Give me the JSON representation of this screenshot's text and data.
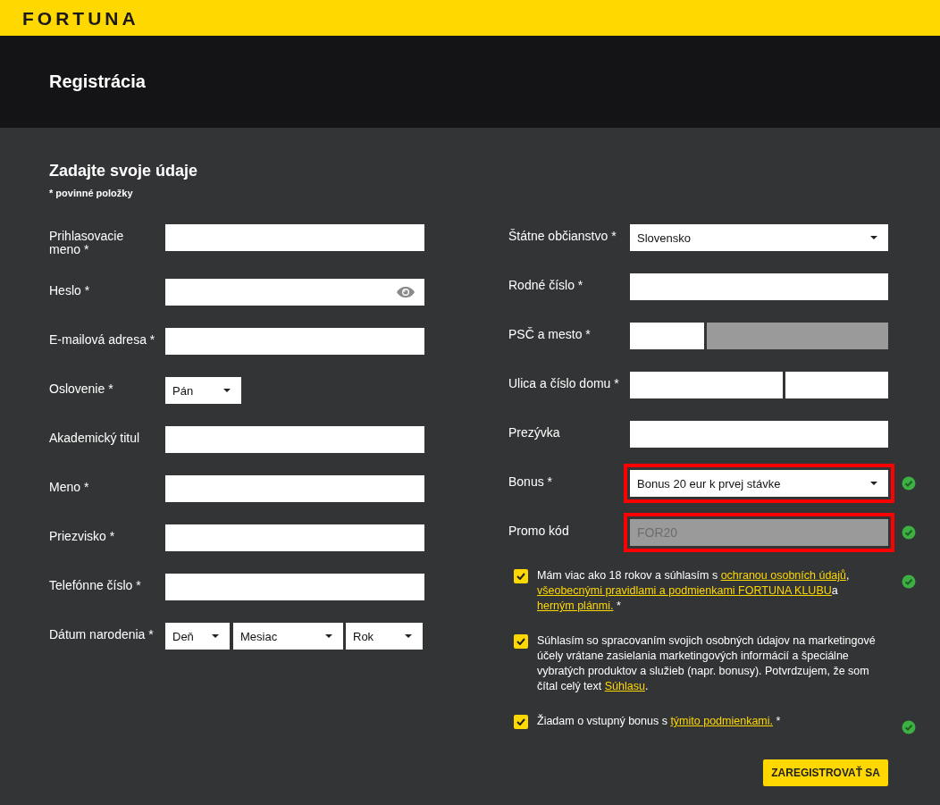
{
  "brand": {
    "logo": "FORTUNA"
  },
  "page_title": "Registrácia",
  "form": {
    "title": "Zadajte svoje údaje",
    "required_note": "* povinné položky",
    "left_fields": [
      {
        "kind": "text",
        "label": "Prihlasovacie meno *"
      },
      {
        "kind": "password",
        "label": "Heslo *"
      },
      {
        "kind": "text",
        "label": "E-mailová adresa *"
      },
      {
        "kind": "select",
        "label": "Oslovenie *",
        "value": "Pán"
      },
      {
        "kind": "text",
        "label": "Akademický titul"
      },
      {
        "kind": "text",
        "label": "Meno *"
      },
      {
        "kind": "text",
        "label": "Priezvisko *"
      },
      {
        "kind": "text",
        "label": "Telefónne číslo *"
      },
      {
        "kind": "date",
        "label": "Dátum narodenia *",
        "parts": [
          "Deň",
          "Mesiac",
          "Rok"
        ]
      }
    ],
    "right_fields": [
      {
        "kind": "select",
        "label": "Štátne občianstvo *",
        "value": "Slovensko",
        "highlighted": false,
        "valid": false
      },
      {
        "kind": "text",
        "label": "Rodné číslo *",
        "highlighted": false,
        "valid": false
      },
      {
        "kind": "zip_city",
        "label": "PSČ a mesto *",
        "parts": [
          {
            "disabled": false
          },
          {
            "disabled": true
          }
        ],
        "valid": false
      },
      {
        "kind": "street_number",
        "label": "Ulica a číslo domu *",
        "parts": [
          {
            "disabled": false
          },
          {
            "disabled": false
          }
        ],
        "valid": false
      },
      {
        "kind": "text",
        "label": "Prezývka",
        "highlighted": false,
        "valid": false
      },
      {
        "kind": "select",
        "label": "Bonus *",
        "value": "Bonus 20 eur k prvej stávke",
        "highlighted": true,
        "valid": true
      },
      {
        "kind": "text",
        "label": "Promo kód",
        "value": "FOR20",
        "disabled": true,
        "highlighted": true,
        "valid": true
      }
    ],
    "consents": [
      {
        "checked": true,
        "valid": true,
        "parts": [
          {
            "text": "Mám viac ako 18 rokov a súhlasím s "
          },
          {
            "text": "ochranou osobních údajů",
            "link": true
          },
          {
            "text": ", "
          },
          {
            "text": "všeobecnými pravidlami a podmienkami FORTUNA KLUBU",
            "link": true
          },
          {
            "text": "a "
          },
          {
            "text": "herným plánmi.",
            "link": true
          },
          {
            "text": " *"
          }
        ]
      },
      {
        "checked": true,
        "valid": false,
        "parts": [
          {
            "text": "Súhlasím so spracovaním svojich osobných údajov na marketingové účely vrátane zasielania marketingových informácií a špeciálne vybratých produktov a služieb (napr. bonusy). Potvrdzujem, že som čítal celý text "
          },
          {
            "text": "Súhlasu",
            "link": true
          },
          {
            "text": "."
          }
        ]
      },
      {
        "checked": true,
        "valid": true,
        "parts": [
          {
            "text": "Žiadam o vstupný bonus s "
          },
          {
            "text": "týmito podmienkami.",
            "link": true
          },
          {
            "text": " *"
          }
        ]
      }
    ],
    "submit": "ZAREGISTROVAŤ SA"
  }
}
